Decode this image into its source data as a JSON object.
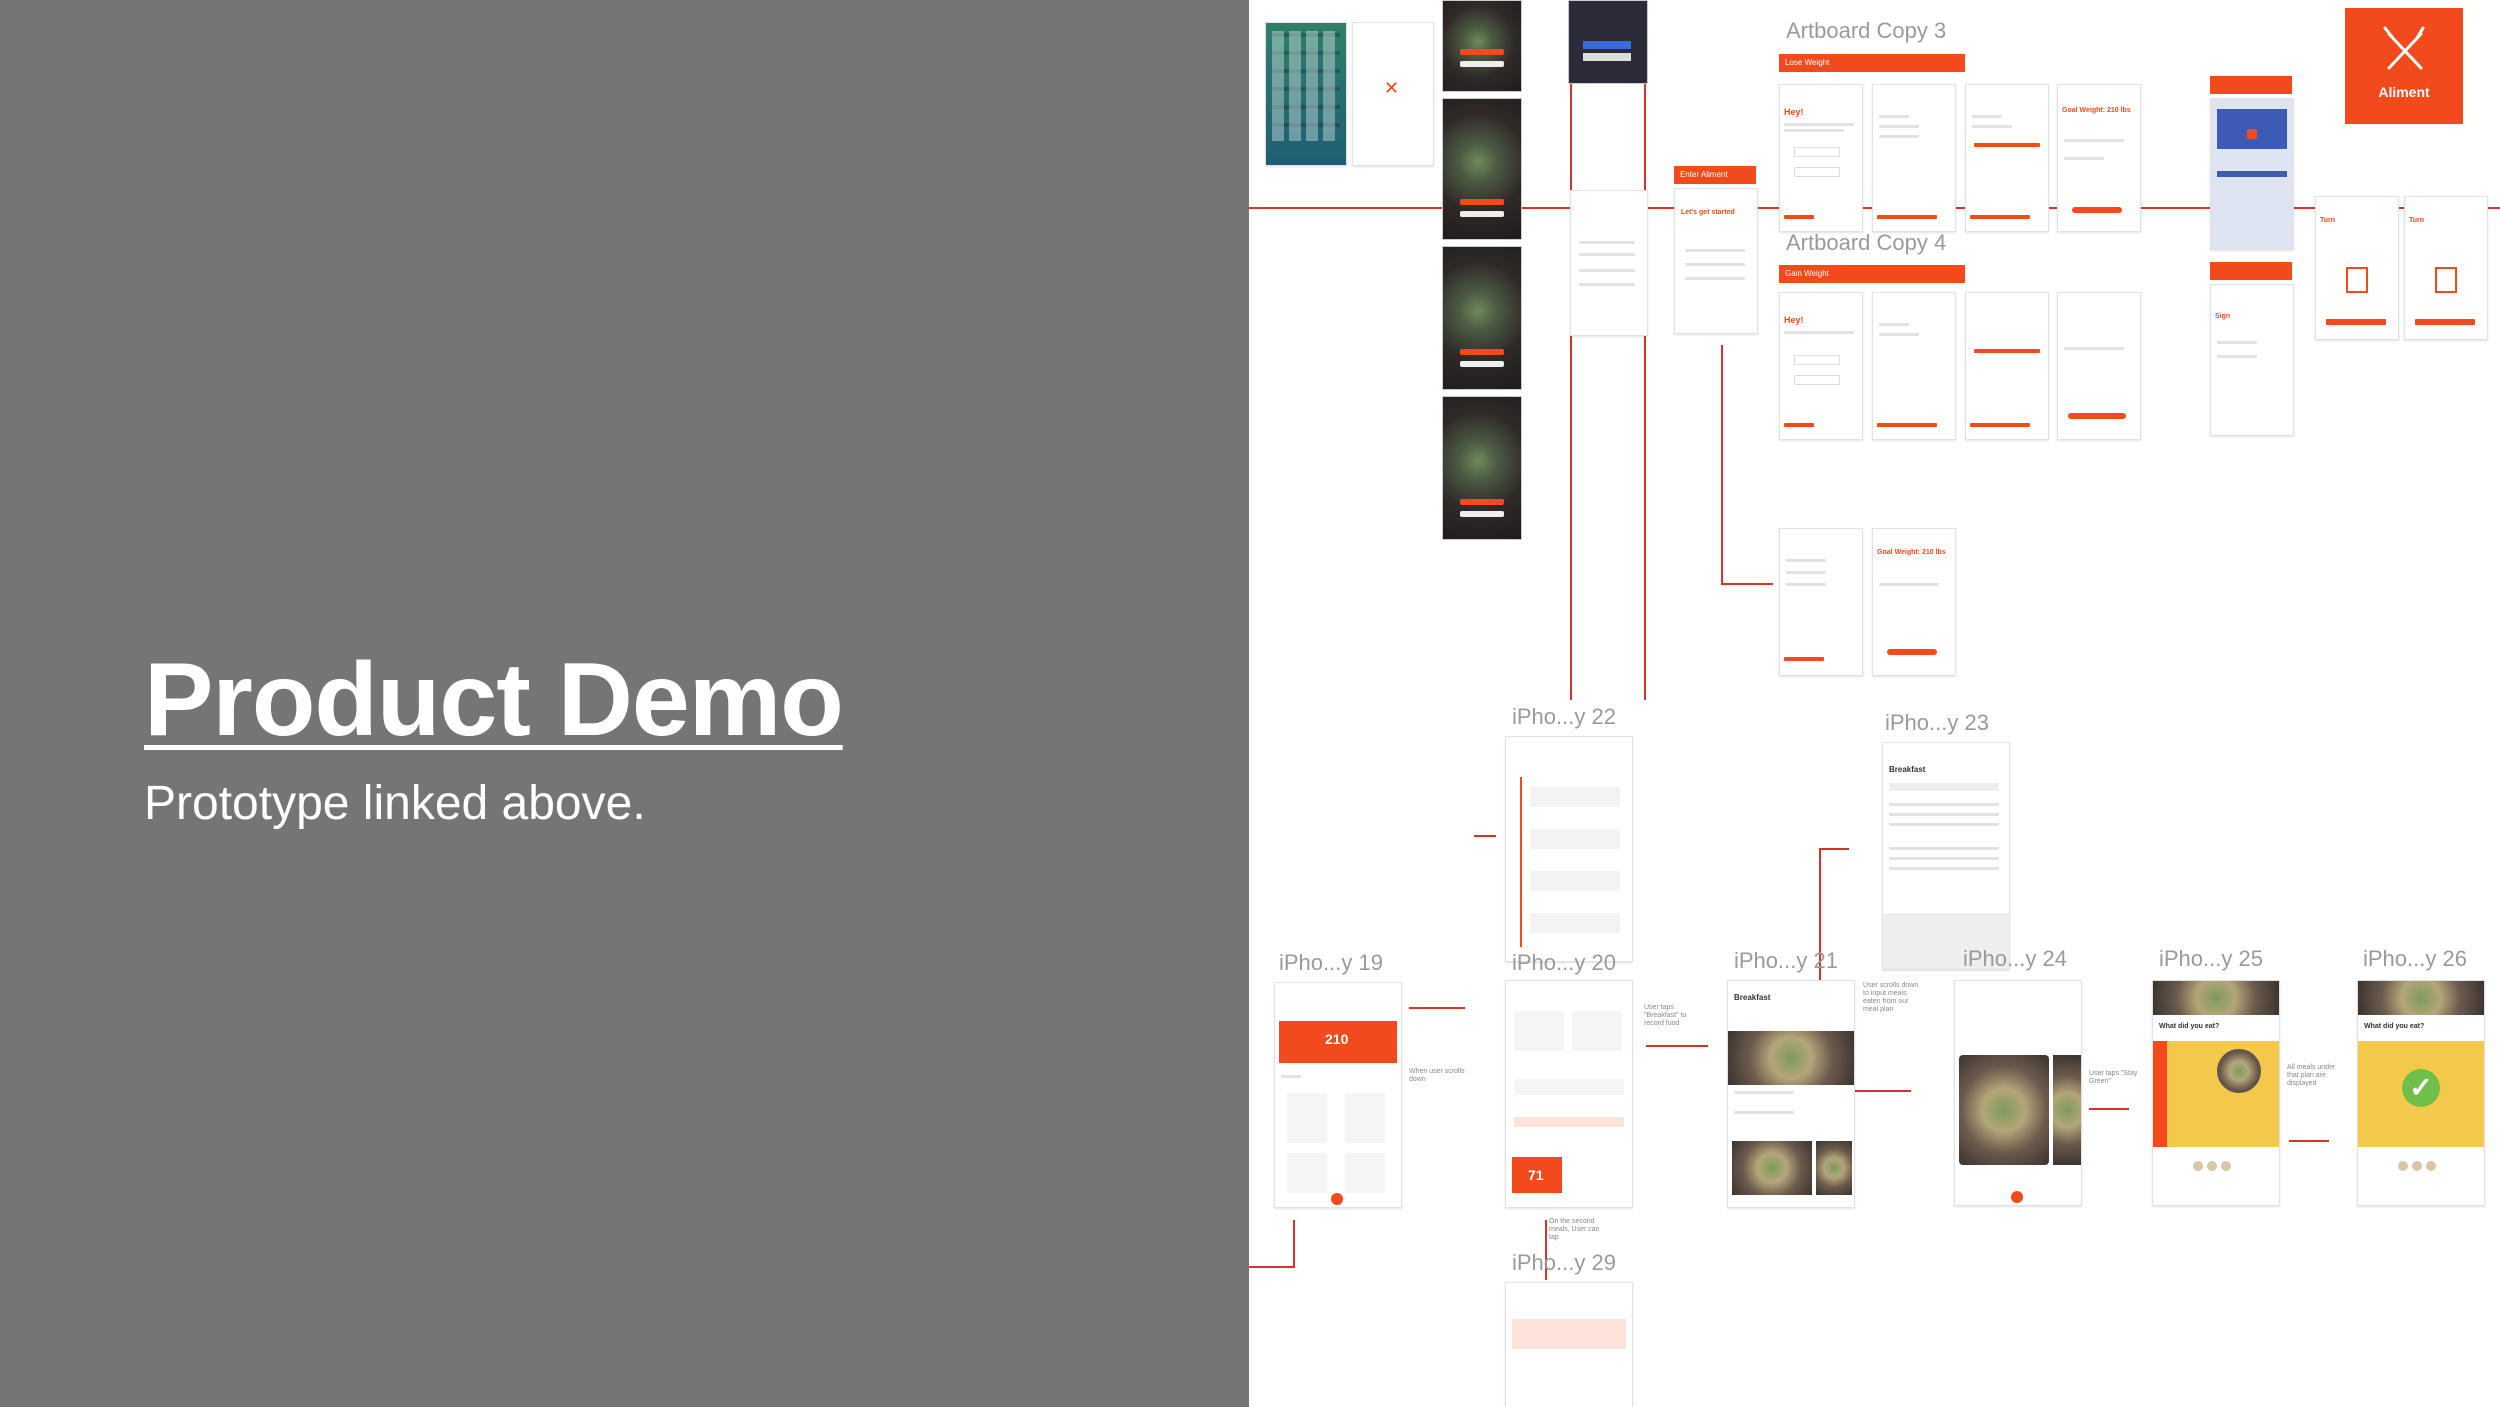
{
  "slide": {
    "title": "Product Demo",
    "subtitle": "Prototype linked above."
  },
  "logo": {
    "name": "Aliment",
    "icon": "fork-knife-icon"
  },
  "artboards": {
    "copy3": "Artboard Copy 3",
    "copy4": "Artboard Copy 4",
    "iph22": "iPho...y 22",
    "iph23": "iPho...y 23",
    "iph19": "iPho...y 19",
    "iph20": "iPho...y 20",
    "iph21": "iPho...y 21",
    "iph24": "iPho...y 24",
    "iph25": "iPho...y 25",
    "iph26": "iPho...y 26",
    "iph29": "iPho...y 29"
  },
  "screens": {
    "lose_weight": "Lose Weight",
    "gain_weight": "Gain Weight",
    "enter_aliment": "Enter Aliment",
    "hey": "Hey!",
    "lets_get_started": "Let's get started",
    "goal_weight": "Goal Weight: 210 lbs",
    "today_value": "210",
    "score_value": "71",
    "breakfast": "Breakfast",
    "what_did_you_eat": "What did you eat?"
  },
  "colors": {
    "accent": "#f24a1c",
    "slide_bg": "#757575",
    "guide_line": "#d7332a"
  }
}
